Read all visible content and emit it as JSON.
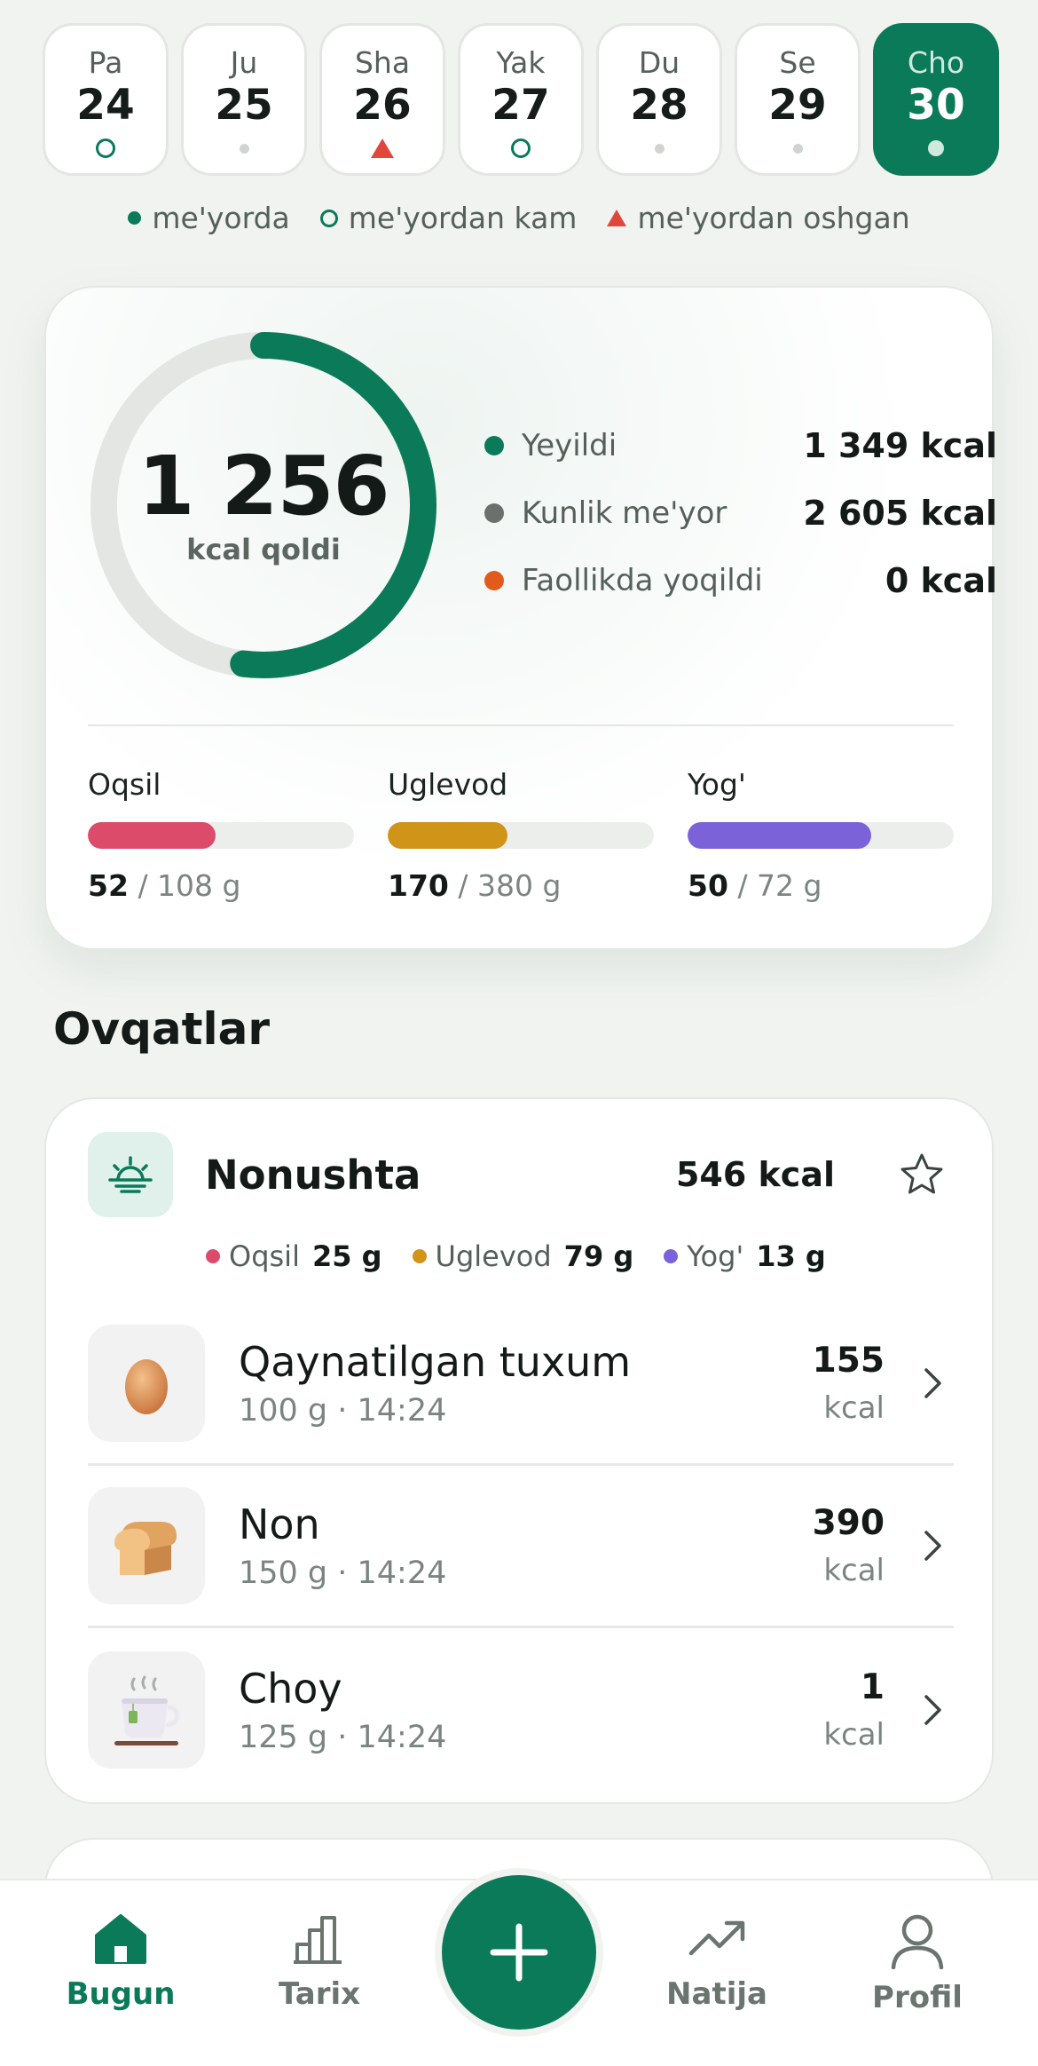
{
  "colors": {
    "primary": "#0b7a59",
    "over_limit": "#e0473c",
    "protein": "#dc4c6a",
    "carbs": "#cf9418",
    "fat": "#7b62d8",
    "burned": "#e25a1c",
    "norm": "#6b706d"
  },
  "days": [
    {
      "name": "Pa",
      "num": "24",
      "status": "below"
    },
    {
      "name": "Ju",
      "num": "25",
      "status": "none"
    },
    {
      "name": "Sha",
      "num": "26",
      "status": "over"
    },
    {
      "name": "Yak",
      "num": "27",
      "status": "below"
    },
    {
      "name": "Du",
      "num": "28",
      "status": "none"
    },
    {
      "name": "Se",
      "num": "29",
      "status": "none"
    },
    {
      "name": "Cho",
      "num": "30",
      "status": "selected"
    }
  ],
  "legend": {
    "normal": "me'yorda",
    "below": "me'yordan kam",
    "over": "me'yordan oshgan"
  },
  "summary": {
    "remaining_value": "1 256",
    "remaining_label": "kcal qoldi",
    "progress_fraction": 0.52,
    "stats": [
      {
        "label": "Yeyildi",
        "value": "1 349 kcal",
        "color": "#0b7a59"
      },
      {
        "label": "Kunlik me'yor",
        "value": "2 605 kcal",
        "color": "#6b706d"
      },
      {
        "label": "Faollikda yoqildi",
        "value": "0 kcal",
        "color": "#e25a1c"
      }
    ],
    "macros": [
      {
        "name": "Oqsil",
        "current": "52",
        "total": "/ 108 g",
        "fraction": 0.48,
        "color": "#dc4c6a"
      },
      {
        "name": "Uglevod",
        "current": "170",
        "total": "/ 380 g",
        "fraction": 0.45,
        "color": "#cf9418"
      },
      {
        "name": "Yog'",
        "current": "50",
        "total": "/ 72 g",
        "fraction": 0.69,
        "color": "#7b62d8"
      }
    ]
  },
  "meals_title": "Ovqatlar",
  "meal": {
    "title": "Nonushta",
    "kcal": "546 kcal",
    "icon": "sunrise-icon",
    "macros": [
      {
        "label": "Oqsil",
        "value": "25 g",
        "color": "#dc4c6a"
      },
      {
        "label": "Uglevod",
        "value": "79 g",
        "color": "#cf9418"
      },
      {
        "label": "Yog'",
        "value": "13 g",
        "color": "#7b62d8"
      }
    ],
    "items": [
      {
        "name": "Qaynatilgan tuxum",
        "meta": "100 g · 14:24",
        "kcal": "155",
        "unit": "kcal",
        "icon": "egg-icon"
      },
      {
        "name": "Non",
        "meta": "150 g · 14:24",
        "kcal": "390",
        "unit": "kcal",
        "icon": "bread-icon"
      },
      {
        "name": "Choy",
        "meta": "125 g · 14:24",
        "kcal": "1",
        "unit": "kcal",
        "icon": "tea-cup-icon"
      }
    ]
  },
  "nav": {
    "today": "Bugun",
    "history": "Tarix",
    "results": "Natija",
    "profile": "Profil",
    "active": "today"
  }
}
